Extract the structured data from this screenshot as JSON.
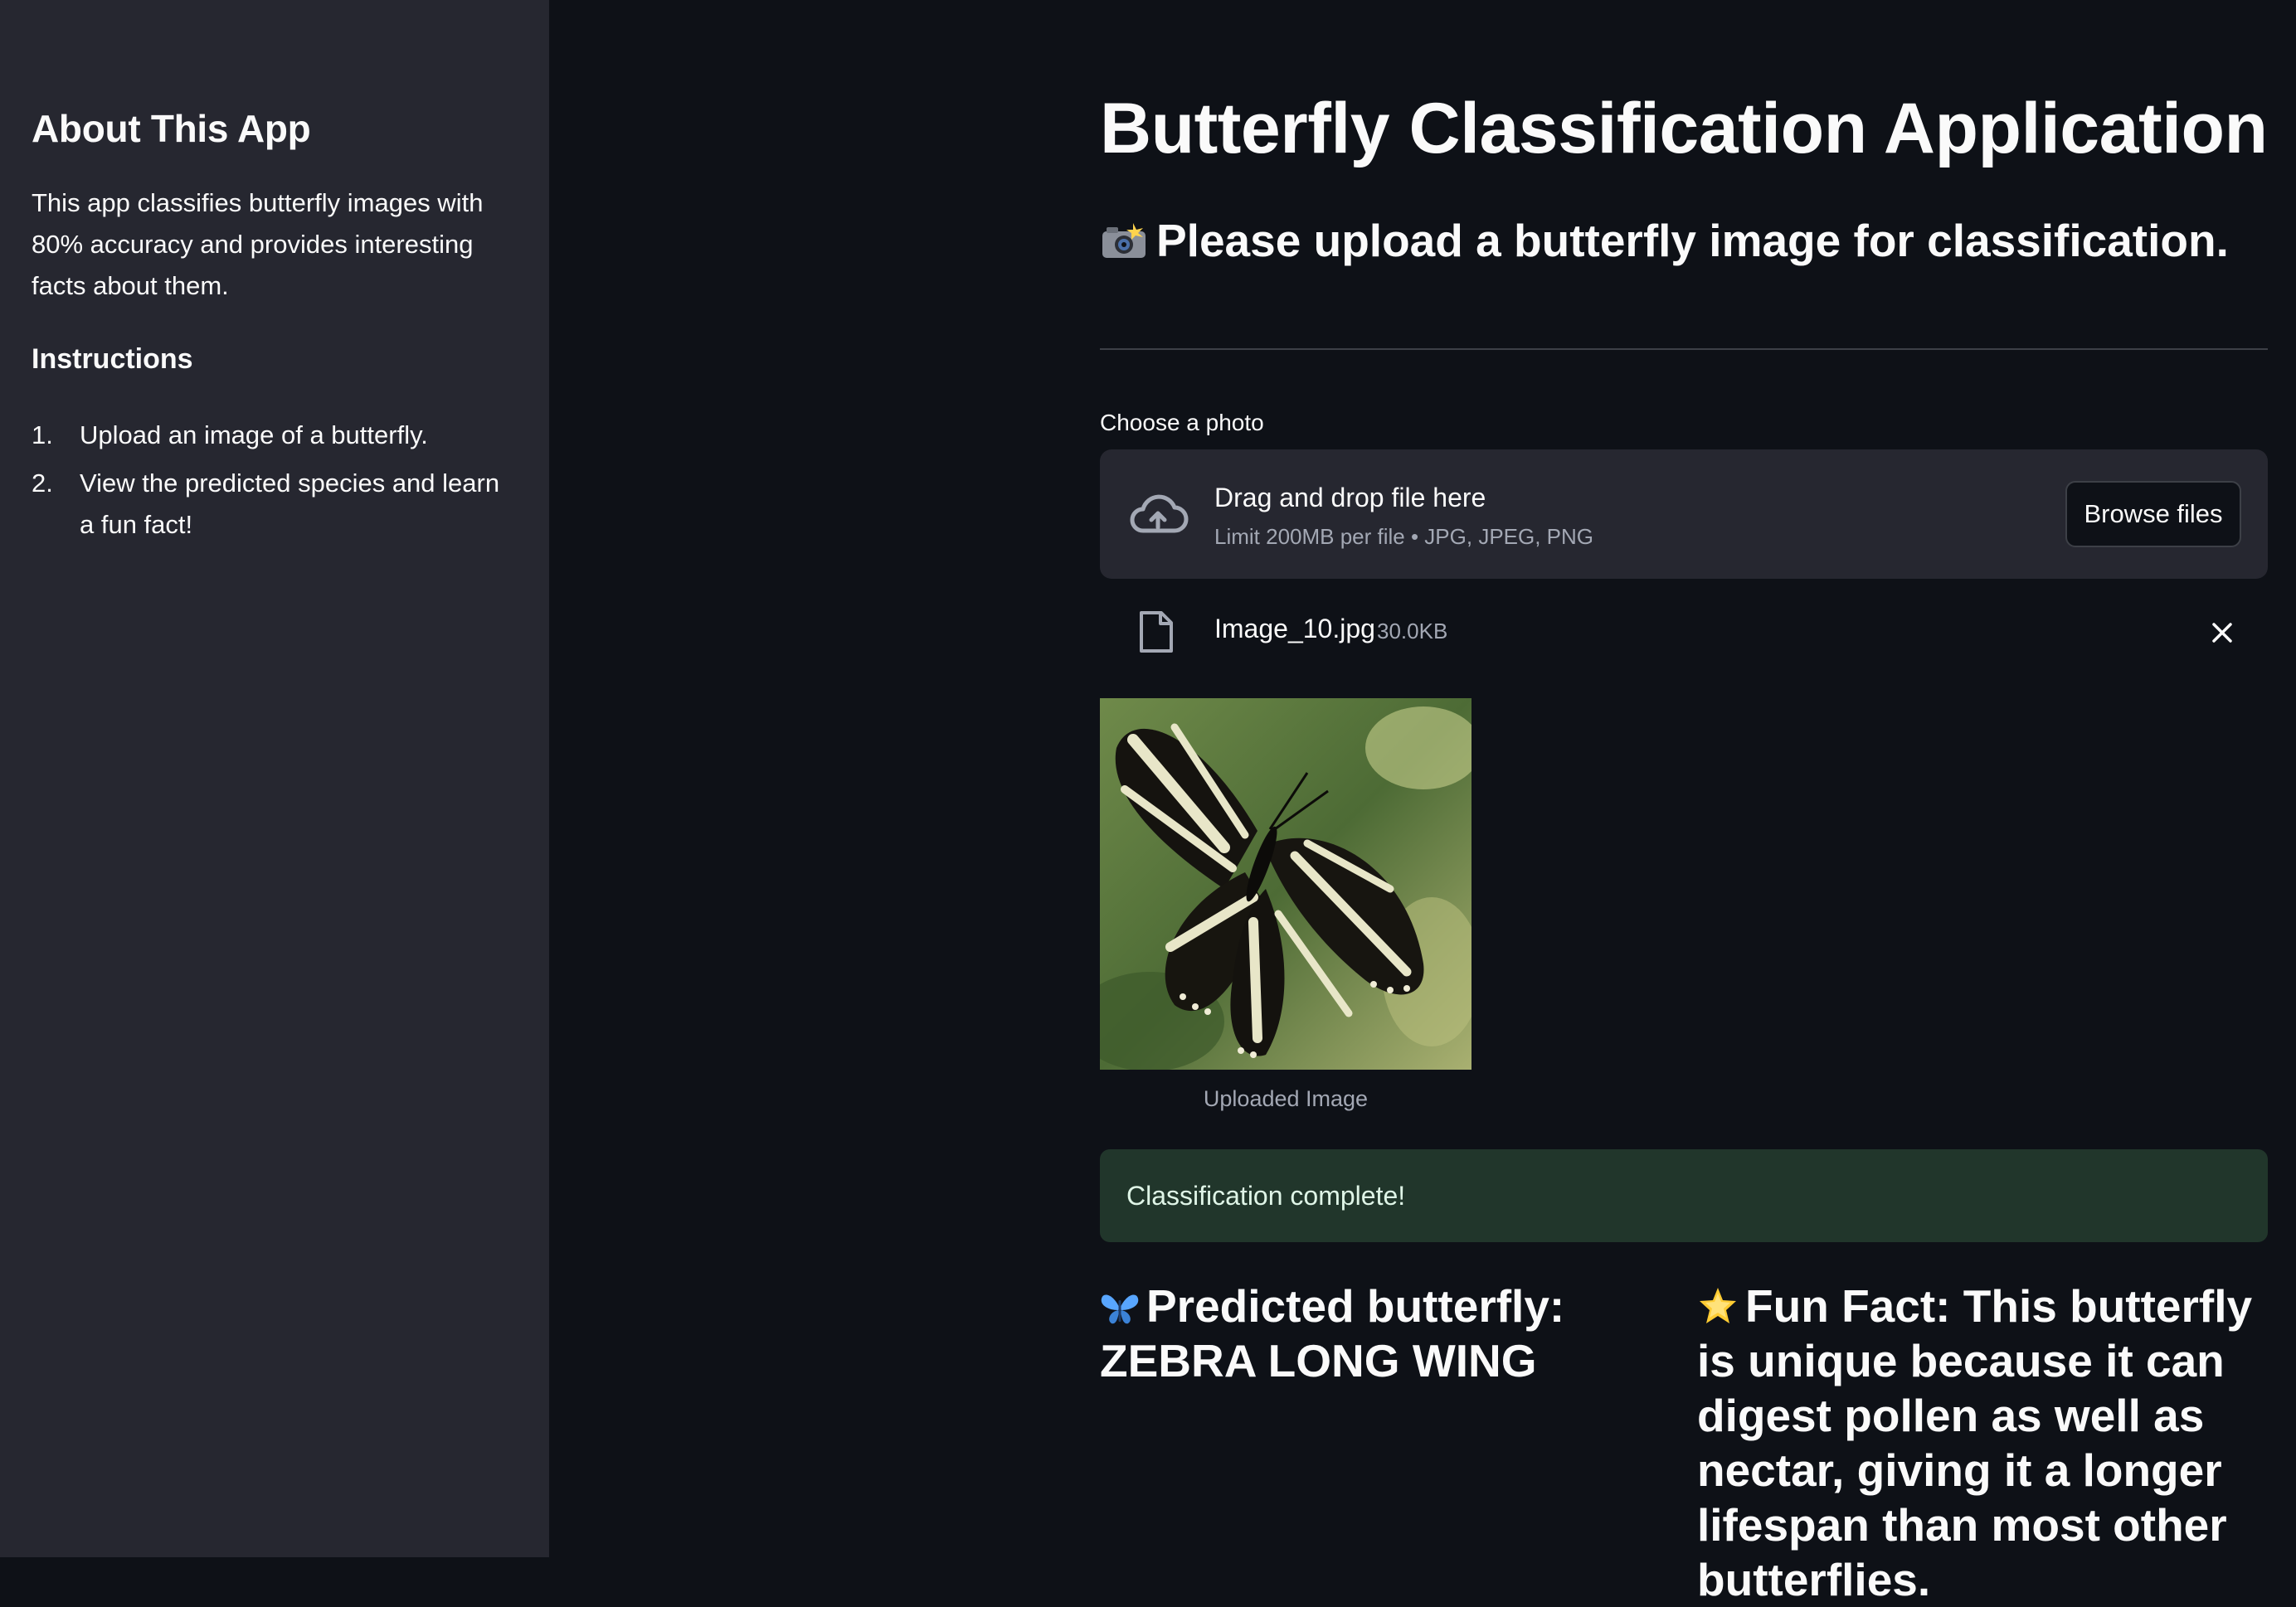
{
  "sidebar": {
    "title": "About This App",
    "description": "This app classifies butterfly images with 80% accuracy and provides interesting facts about them.",
    "instructions_title": "Instructions",
    "instructions": [
      {
        "num": "1.",
        "text": "Upload an image of a butterfly."
      },
      {
        "num": "2.",
        "text": "View the predicted species and learn a fun fact!"
      }
    ]
  },
  "main": {
    "title": "Butterfly Classification Application",
    "subtitle": "Please upload a butterfly image for classification.",
    "subtitle_icon": "camera-flash-icon",
    "uploader": {
      "label": "Choose a photo",
      "drop_text": "Drag and drop file here",
      "limit_text": "Limit 200MB per file • JPG, JPEG, PNG",
      "browse_label": "Browse files"
    },
    "file": {
      "name": "Image_10.jpg",
      "size": "30.0KB"
    },
    "image_caption": "Uploaded Image",
    "success_message": "Classification complete!",
    "prediction": {
      "icon": "butterfly-icon",
      "text": "Predicted butterfly: ZEBRA LONG WING"
    },
    "fun_fact": {
      "icon": "star-icon",
      "text": "Fun Fact: This butterfly is unique because it can digest pollen as well as nectar, giving it a longer lifespan than most other butterflies."
    }
  },
  "colors": {
    "background": "#0e1117",
    "sidebar_bg": "#262730",
    "success_bg": "#21362b",
    "text": "#fafafa",
    "muted_text": "#a3a8b4"
  }
}
